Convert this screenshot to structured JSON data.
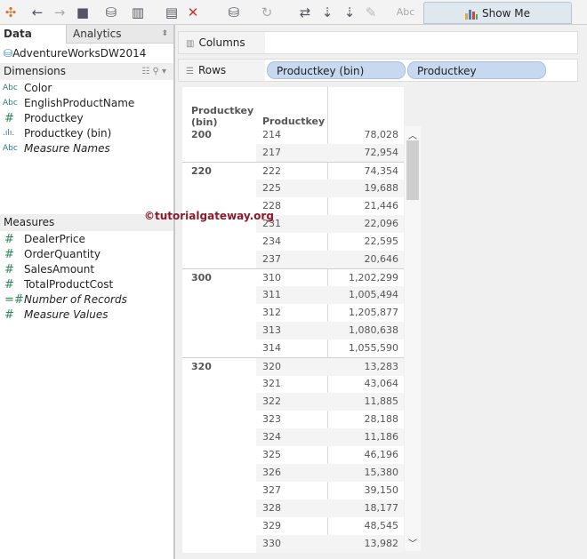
{
  "toolbar": {
    "show_me": "Show Me",
    "abc": "Abc",
    "icons": [
      "tableau-logo-icon",
      "back-icon",
      "forward-icon",
      "save-icon",
      "new-datasource-icon",
      "new-worksheet-icon",
      "duplicate-sheet-icon",
      "clear-sheet-icon",
      "datasource-icon",
      "refresh-icon",
      "swap-icon",
      "sort-asc-icon",
      "sort-desc-icon",
      "highlight-icon",
      "label-icon"
    ]
  },
  "sidebar": {
    "tab_data": "Data",
    "tab_analytics": "Analytics",
    "datasource": "AdventureWorksDW2014",
    "dimensions_label": "Dimensions",
    "measures_label": "Measures",
    "dimensions": [
      {
        "type": "Abc",
        "label": "Color"
      },
      {
        "type": "Abc",
        "label": "EnglishProductName"
      },
      {
        "type": "#",
        "label": "Productkey"
      },
      {
        "type": ".ılı.",
        "label": "Productkey (bin)"
      },
      {
        "type": "Abc",
        "label": "Measure Names",
        "italic": true
      }
    ],
    "measures": [
      {
        "type": "#",
        "label": "DealerPrice"
      },
      {
        "type": "#",
        "label": "OrderQuantity"
      },
      {
        "type": "#",
        "label": "SalesAmount"
      },
      {
        "type": "#",
        "label": "TotalProductCost"
      },
      {
        "type": "=#",
        "label": "Number of Records",
        "italic": true
      },
      {
        "type": "#",
        "label": "Measure Values",
        "italic": true
      }
    ]
  },
  "watermark": "©tutorialgateway.org",
  "shelves": {
    "columns_label": "Columns",
    "rows_label": "Rows",
    "rows_pills": [
      "Productkey (bin)",
      "Productkey"
    ]
  },
  "table": {
    "header_bin": "Productkey (bin)",
    "header_key": "Productkey",
    "rows": [
      [
        "200",
        "214",
        "78,028"
      ],
      [
        "",
        "217",
        "72,954"
      ],
      [
        "220",
        "222",
        "74,354"
      ],
      [
        "",
        "225",
        "19,688"
      ],
      [
        "",
        "228",
        "21,446"
      ],
      [
        "",
        "231",
        "22,096"
      ],
      [
        "",
        "234",
        "22,595"
      ],
      [
        "",
        "237",
        "20,646"
      ],
      [
        "300",
        "310",
        "1,202,299"
      ],
      [
        "",
        "311",
        "1,005,494"
      ],
      [
        "",
        "312",
        "1,205,877"
      ],
      [
        "",
        "313",
        "1,080,638"
      ],
      [
        "",
        "314",
        "1,055,590"
      ],
      [
        "320",
        "320",
        "13,283"
      ],
      [
        "",
        "321",
        "43,064"
      ],
      [
        "",
        "322",
        "11,885"
      ],
      [
        "",
        "323",
        "28,188"
      ],
      [
        "",
        "324",
        "11,186"
      ],
      [
        "",
        "325",
        "46,196"
      ],
      [
        "",
        "326",
        "15,380"
      ],
      [
        "",
        "327",
        "39,150"
      ],
      [
        "",
        "328",
        "18,177"
      ],
      [
        "",
        "329",
        "48,545"
      ],
      [
        "",
        "330",
        "13,982"
      ]
    ]
  }
}
